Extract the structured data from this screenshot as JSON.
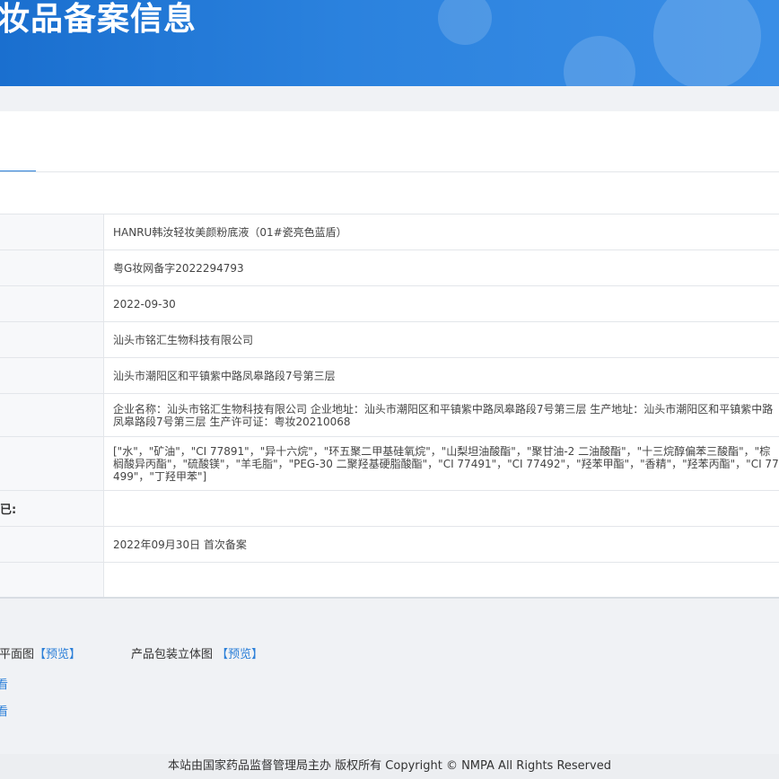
{
  "header": {
    "title": "化妆品备案信息"
  },
  "product": {
    "rows": [
      {
        "label": "",
        "value": "HANRU韩汝轻妆美颜粉底液（01#瓷亮色蓝盾）"
      },
      {
        "label": "",
        "value": "粤G妆网备字2022294793"
      },
      {
        "label": "",
        "value": "2022-09-30"
      },
      {
        "label": "",
        "value": "汕头市铭汇生物科技有限公司"
      },
      {
        "label": "",
        "value": "汕头市潮阳区和平镇紫中路凤皋路段7号第三层"
      },
      {
        "label": "",
        "value": "企业名称：汕头市铭汇生物科技有限公司 企业地址：汕头市潮阳区和平镇紫中路凤皋路段7号第三层 生产地址：汕头市潮阳区和平镇紫中路凤皋路段7号第三层 生产许可证：粤妆20210068"
      },
      {
        "label": "",
        "value": "[\"水\"，\"矿油\"，\"CI 77891\"，\"异十六烷\"，\"环五聚二甲基硅氧烷\"，\"山梨坦油酸酯\"，\"聚甘油-2 二油酸酯\"，\"十三烷醇偏苯三酸酯\"，\"棕榈酸异丙酯\"，\"硫酸镁\"，\"羊毛脂\"，\"PEG-30 二聚羟基硬脂酸酯\"，\"CI 77491\"，\"CI 77492\"，\"羟苯甲酯\"，\"香精\"，\"羟苯丙酯\"，\"CI 77499\"，\"丁羟甲苯\"]"
      },
      {
        "label": "已:",
        "value": ""
      },
      {
        "label": "",
        "value": "2022年09月30日 首次备案"
      },
      {
        "label": "",
        "value": ""
      }
    ]
  },
  "images": {
    "flat_label": "装平面图",
    "flat_link": "【预览】",
    "stereo_label": "产品包装立体图",
    "stereo_link": "【预览】",
    "view_links": [
      "看",
      "看"
    ]
  },
  "footer": {
    "text": "本站由国家药品监督管理局主办 版权所有 Copyright © NMPA All Rights Reserved"
  }
}
